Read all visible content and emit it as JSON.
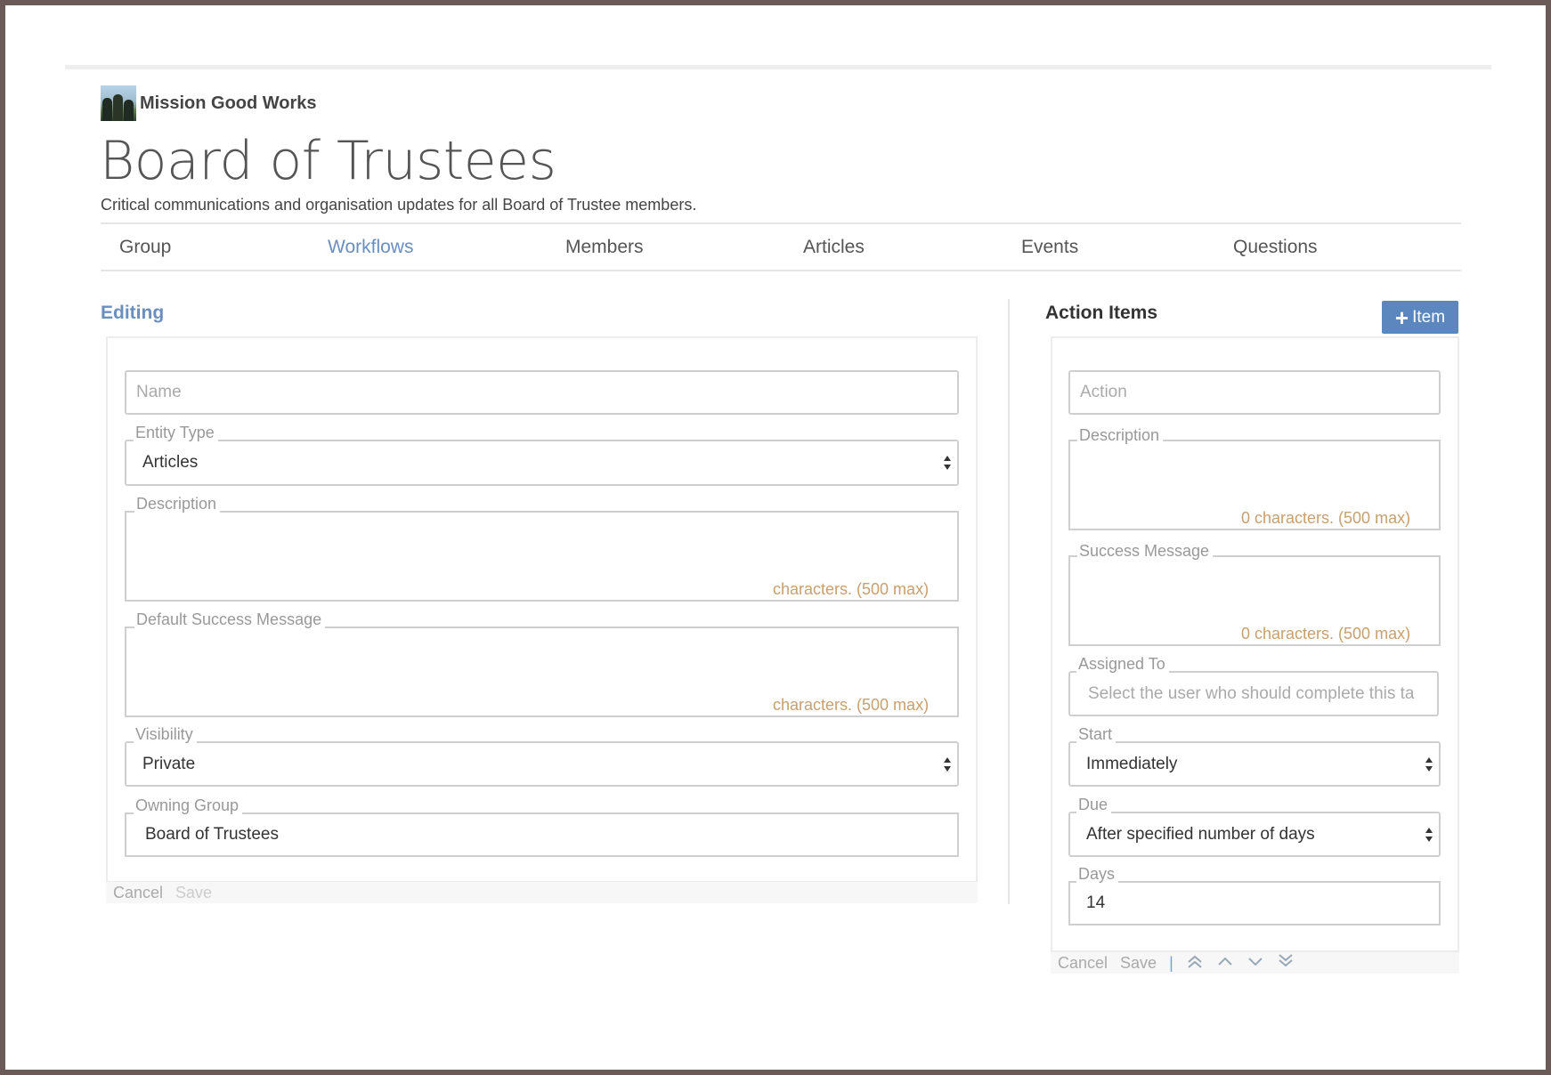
{
  "org": {
    "name": "Mission Good Works",
    "logo_icon": "org-photo-logo"
  },
  "page": {
    "title": "Board of Trustees",
    "subtitle": "Critical communications and organisation updates for all Board of Trustee members."
  },
  "tabs": [
    {
      "label": "Group",
      "active": false
    },
    {
      "label": "Workflows",
      "active": true
    },
    {
      "label": "Members",
      "active": false
    },
    {
      "label": "Articles",
      "active": false
    },
    {
      "label": "Events",
      "active": false
    },
    {
      "label": "Questions",
      "active": false
    }
  ],
  "editing": {
    "title": "Editing",
    "name_placeholder": "Name",
    "entity_type": {
      "label": "Entity Type",
      "value": "Articles"
    },
    "description": {
      "label": "Description",
      "counter": "characters. (500 max)"
    },
    "default_success": {
      "label": "Default Success Message",
      "counter": "characters. (500 max)"
    },
    "visibility": {
      "label": "Visibility",
      "value": "Private"
    },
    "owning_group": {
      "label": "Owning Group",
      "value": "Board of Trustees"
    },
    "footer": {
      "cancel": "Cancel",
      "save": "Save"
    }
  },
  "action_items": {
    "title": "Action Items",
    "add_button": {
      "icon": "plus-icon",
      "label": "Item"
    },
    "action_placeholder": "Action",
    "description": {
      "label": "Description",
      "counter": "0 characters. (500 max)"
    },
    "success_message": {
      "label": "Success Message",
      "counter": "0 characters. (500 max)"
    },
    "assigned_to": {
      "label": "Assigned To",
      "placeholder": "Select the user who should complete this ta"
    },
    "start": {
      "label": "Start",
      "value": "Immediately"
    },
    "due": {
      "label": "Due",
      "value": "After specified number of days"
    },
    "days": {
      "label": "Days",
      "value": "14"
    },
    "footer": {
      "cancel": "Cancel",
      "save": "Save",
      "separator": "|",
      "controls": [
        "move-top-icon",
        "move-up-icon",
        "move-down-icon",
        "move-bottom-icon"
      ]
    }
  },
  "colors": {
    "accent": "#5b87be",
    "link": "#6a8fbf",
    "counter": "#c89f6e",
    "frame": "#6b5b58"
  }
}
